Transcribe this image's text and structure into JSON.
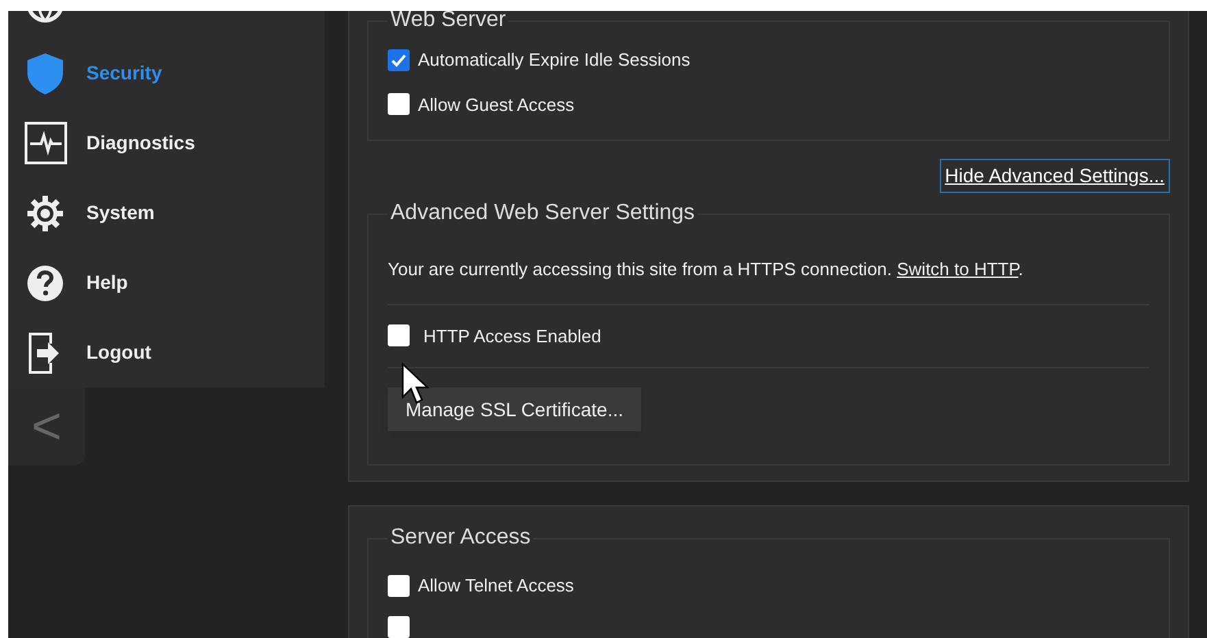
{
  "sidebar": {
    "items": [
      {
        "selected": false
      },
      {
        "label": "Security",
        "selected": true
      },
      {
        "label": "Diagnostics",
        "selected": false
      },
      {
        "label": "System",
        "selected": false
      },
      {
        "label": "Help",
        "selected": false
      },
      {
        "label": "Logout",
        "selected": false
      }
    ],
    "collapse": "<"
  },
  "web_server": {
    "legend": "Web Server",
    "options": [
      {
        "label": "Automatically Expire Idle Sessions",
        "checked": true
      },
      {
        "label": "Allow Guest Access",
        "checked": false
      }
    ]
  },
  "advanced_toggle": "Hide Advanced Settings...",
  "advanced": {
    "legend": "Advanced Web Server Settings",
    "notice": "Your are currently accessing this site from a HTTPS connection. ",
    "notice_link": "Switch to HTTP",
    "notice_end": ".",
    "http_access": {
      "label": "HTTP Access Enabled",
      "checked": false
    },
    "button": "Manage SSL Certificate..."
  },
  "server_access": {
    "legend": "Server Access",
    "options": [
      {
        "label": "Allow Telnet Access",
        "checked": false
      },
      {
        "checked": false
      }
    ]
  }
}
